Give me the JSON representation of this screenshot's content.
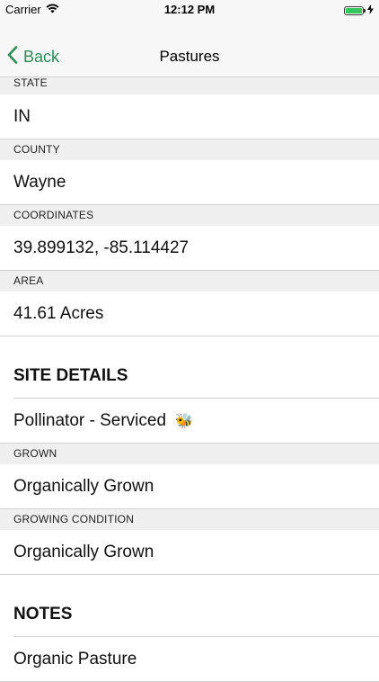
{
  "status": {
    "carrier": "Carrier",
    "time": "12:12 PM",
    "battery_level": 1.0,
    "battery_color": "#34c759",
    "wifi_icon": "wifi-icon",
    "charging_icon": "bolt-icon"
  },
  "nav": {
    "back_label": "Back",
    "title": "Pastures",
    "accent": "#2e8b57"
  },
  "fields": [
    {
      "label": "STATE",
      "value": "IN"
    },
    {
      "label": "COUNTY",
      "value": "Wayne"
    },
    {
      "label": "COORDINATES",
      "value": "39.899132, -85.114427"
    },
    {
      "label": "AREA",
      "value": "41.61 Acres"
    }
  ],
  "site_details": {
    "title": "SITE DETAILS",
    "pollinator": {
      "text": "Pollinator - Serviced",
      "icon": "bee-icon",
      "emoji": "🐝"
    },
    "fields": [
      {
        "label": "GROWN",
        "value": "Organically Grown"
      },
      {
        "label": "GROWING CONDITION",
        "value": "Organically Grown"
      }
    ]
  },
  "notes": {
    "title": "NOTES",
    "value": "Organic Pasture"
  }
}
